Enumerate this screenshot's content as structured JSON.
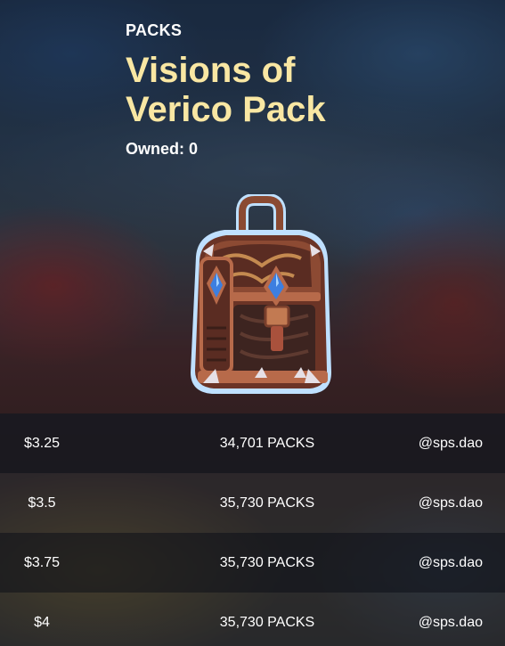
{
  "header": {
    "section_label": "PACKS",
    "title": "Visions of Verico Pack",
    "owned_label": "Owned: 0"
  },
  "pack_image": {
    "icon": "treasure-chest-icon",
    "colors": {
      "wood": "#7a3f2c",
      "trim": "#b76a4a",
      "gem": "#3d7fe0",
      "outline": "#bfe0ff"
    }
  },
  "listings": [
    {
      "price": "$3.25",
      "quantity": "34,701 PACKS",
      "seller": "@sps.dao"
    },
    {
      "price": "$3.5",
      "quantity": "35,730 PACKS",
      "seller": "@sps.dao"
    },
    {
      "price": "$3.75",
      "quantity": "35,730 PACKS",
      "seller": "@sps.dao"
    },
    {
      "price": "$4",
      "quantity": "35,730 PACKS",
      "seller": "@sps.dao"
    }
  ],
  "colors": {
    "title": "#f9e7a3",
    "text": "#ffffff"
  }
}
